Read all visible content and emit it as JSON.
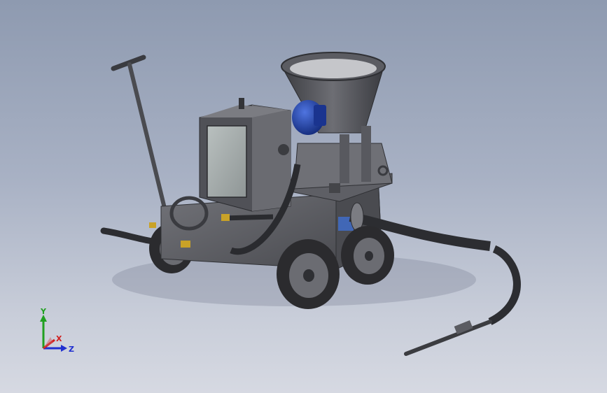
{
  "viewport": {
    "background_top": "#8e9ab0",
    "background_bottom": "#d6d9e2"
  },
  "model": {
    "body_color": "#55565c",
    "motor_color": "#1f3fa8",
    "brass_color": "#c9a227",
    "tire_color": "#2b2b2e"
  },
  "triad": {
    "x_label": "X",
    "y_label": "Y",
    "z_label": "Z",
    "x_color": "#d02020",
    "y_color": "#20a020",
    "z_color": "#2030d0"
  }
}
